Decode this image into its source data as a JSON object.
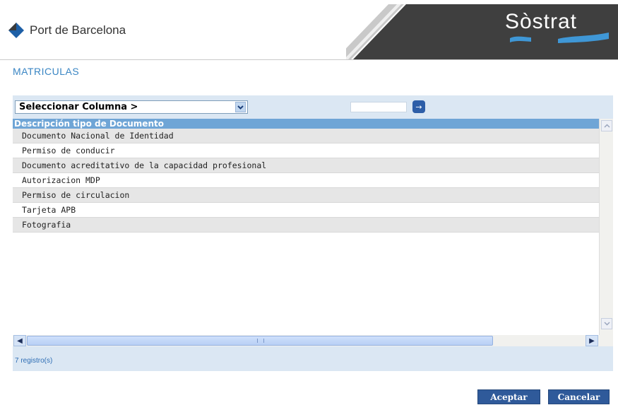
{
  "header": {
    "logo_text": "Port de Barcelona",
    "brand": "Sòstrat",
    "colors": {
      "banner": "#3f3f3f",
      "brand_wave": "#3f97d6"
    }
  },
  "page_title": "MATRICULAS",
  "toolbar": {
    "column_select_value": "Seleccionar Columna >",
    "search_value": "",
    "go_icon": "arrow-right-icon"
  },
  "grid": {
    "column_header": "Descripción tipo de Documento",
    "rows": [
      "Documento Nacional de Identidad",
      "Permiso de conducir",
      "Documento acreditativo de la capacidad profesional",
      "Autorizacion MDP",
      "Permiso de circulacion",
      "Tarjeta APB",
      "Fotografia"
    ]
  },
  "status": "7 registro(s)",
  "buttons": {
    "accept": "Aceptar",
    "cancel": "Cancelar"
  }
}
